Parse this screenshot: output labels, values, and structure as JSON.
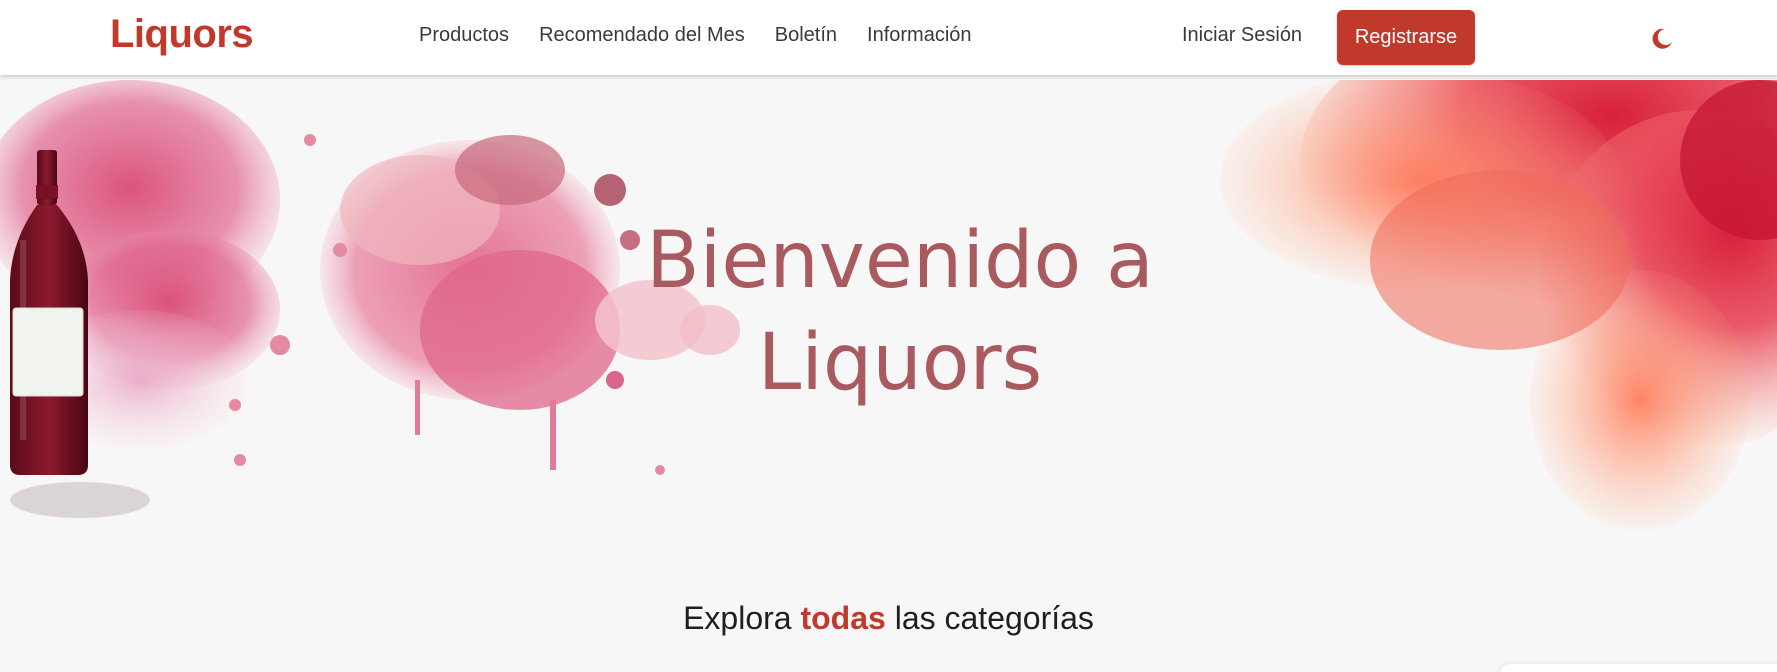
{
  "header": {
    "logo": "Liquors",
    "nav": [
      "Productos",
      "Recomendado del Mes",
      "Boletín",
      "Información"
    ],
    "login_label": "Iniciar Sesión",
    "register_label": "Registrarse",
    "theme_icon": "moon-icon"
  },
  "hero": {
    "title_line1": "Bienvenido a",
    "title_line2": "Liquors"
  },
  "categories": {
    "prefix": "Explora",
    "accent": "todas",
    "suffix": "las categorías"
  },
  "colors": {
    "brand": "#c0392b",
    "hero_title": "#a85a5f",
    "background": "#f8f7f7"
  }
}
